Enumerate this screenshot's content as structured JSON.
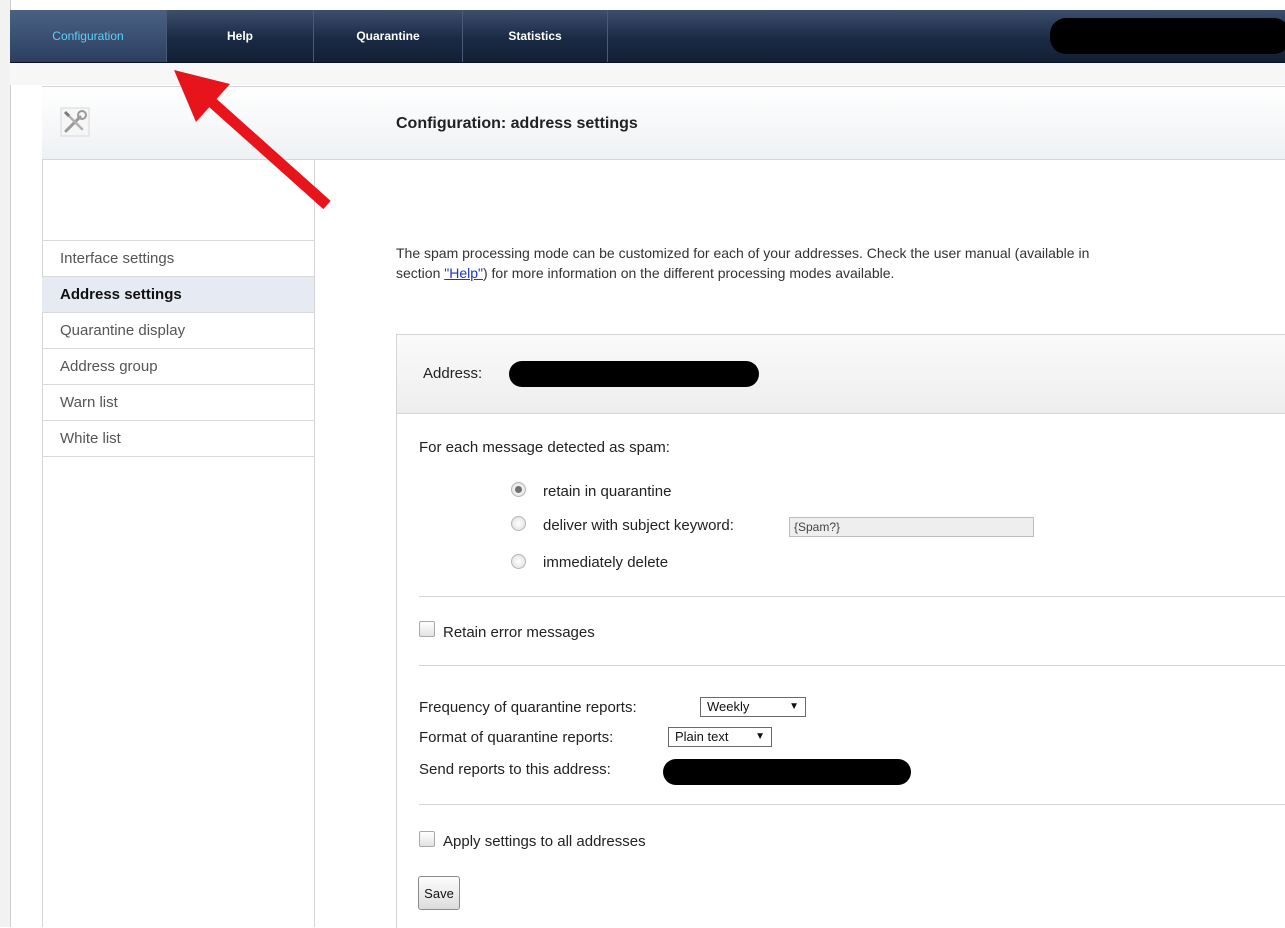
{
  "nav": {
    "tabs": [
      {
        "label": "Configuration",
        "active": true
      },
      {
        "label": "Help",
        "active": false
      },
      {
        "label": "Quarantine",
        "active": false
      },
      {
        "label": "Statistics",
        "active": false
      }
    ]
  },
  "header": {
    "title": "Configuration: address settings",
    "icon": "wrench-screwdriver-icon"
  },
  "sidebar": {
    "items": [
      {
        "label": "Interface settings",
        "active": false
      },
      {
        "label": "Address settings",
        "active": true
      },
      {
        "label": "Quarantine display",
        "active": false
      },
      {
        "label": "Address group",
        "active": false
      },
      {
        "label": "Warn list",
        "active": false
      },
      {
        "label": "White list",
        "active": false
      }
    ]
  },
  "intro": {
    "line1": "The spam processing mode can be customized for each of your addresses. Check the user manual (available in",
    "line2_pre": "section ",
    "help_link": "\"Help\"",
    "line2_post": ") for more information on the different processing modes available."
  },
  "form": {
    "address_label": "Address:",
    "spam_heading": "For each message detected as spam:",
    "options": {
      "retain": "retain in quarantine",
      "deliver": "deliver with subject keyword:",
      "delete": "immediately delete",
      "selected": "retain"
    },
    "subject_keyword": "{Spam?}",
    "retain_errors_label": "Retain error messages",
    "retain_errors_checked": false,
    "frequency_label": "Frequency of quarantine reports:",
    "frequency_value": "Weekly",
    "format_label": "Format of quarantine reports:",
    "format_value": "Plain text",
    "send_label": "Send reports to this address:",
    "apply_all_label": "Apply settings to all addresses",
    "apply_all_checked": false,
    "save_label": "Save"
  },
  "colors": {
    "nav_bg": "#1b2a44",
    "nav_active_text": "#5fd0f5",
    "link": "#1a33c9",
    "annotation_arrow": "#e8141b"
  }
}
